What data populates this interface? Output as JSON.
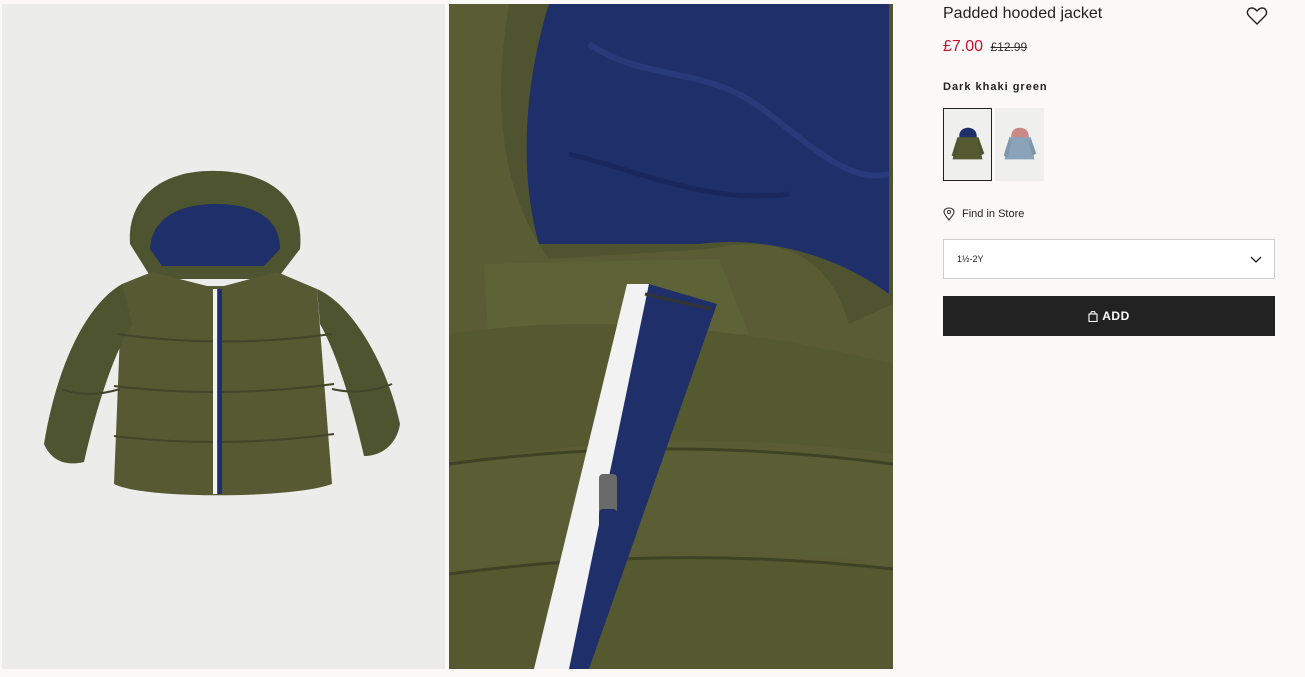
{
  "product": {
    "title": "Padded hooded jacket",
    "price_sale": "£7.00",
    "price_old": "£12.99",
    "color_name": "Dark khaki green",
    "favourite_icon": "heart-icon"
  },
  "swatches": [
    {
      "color": "#555a32",
      "selected": true
    },
    {
      "color": "#8aa3b8",
      "selected": false
    }
  ],
  "store": {
    "label": "Find in Store",
    "icon": "location-pin-icon"
  },
  "size_select": {
    "value": "1½-2Y",
    "icon": "chevron-down-icon"
  },
  "add_button": {
    "label": "ADD",
    "icon": "shopping-bag-icon"
  },
  "colors": {
    "sale": "#c8102e",
    "button": "#222222",
    "jacket": "#555a32",
    "lining": "#1f2f6a"
  }
}
